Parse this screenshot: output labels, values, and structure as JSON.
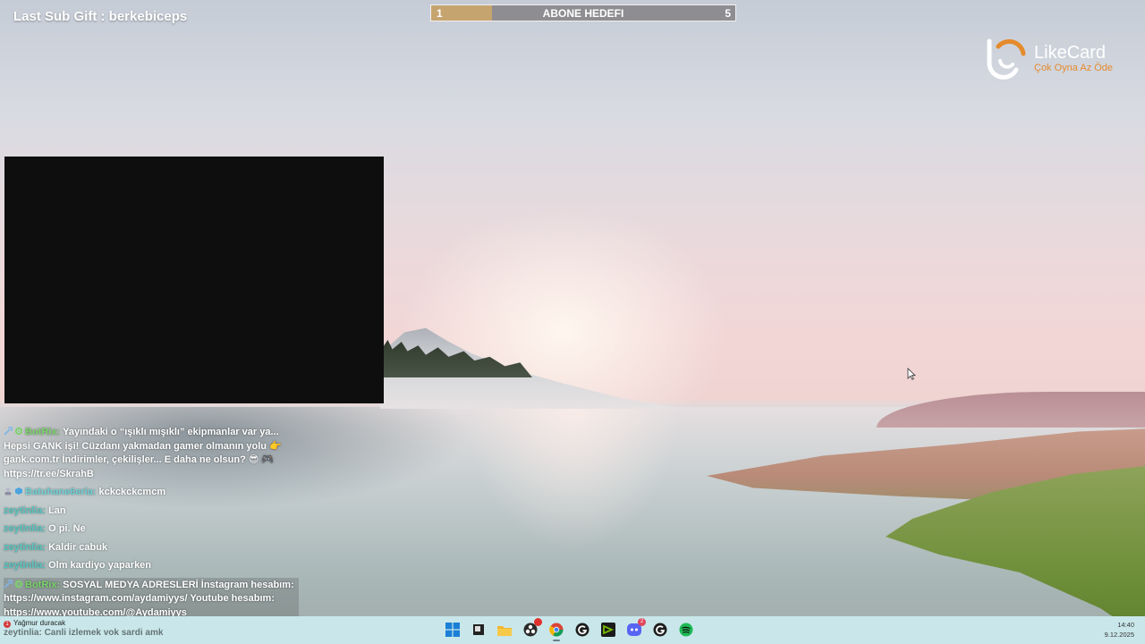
{
  "overlay": {
    "last_sub_gift": "Last Sub Gift : berkebiceps"
  },
  "sub_goal": {
    "title": "ABONE HEDEFI",
    "current": "1",
    "target": "5",
    "progress_fraction": 0.2,
    "fill_color": "#c6a46f",
    "track_color": "#8e8d91"
  },
  "sponsor": {
    "name": "LikeCard",
    "tagline": "Çok Oyna Az Öde",
    "accent_color": "#e58b2c"
  },
  "chat": {
    "messages": [
      {
        "user": "BotRix:",
        "text": "Yayındaki o “ışıklı mışıklı” ekipmanlar var ya... Hepsi GANK işi! Cüzdanı yakmadan gamer olmanın yolu 👉 gank.com.tr İndirimler, çekilişler... E daha ne olsun? 😎 🎮 https://tr.ee/SkrahB"
      },
      {
        "user": "Batuhane6eria:",
        "text": "kckckckcmcm"
      },
      {
        "user": "zeytinlia:",
        "text": "Lan"
      },
      {
        "user": "zeytinlia:",
        "text": "O pi. Ne"
      },
      {
        "user": "zeytinlia:",
        "text": "Kaldir cabuk"
      },
      {
        "user": "zeytinlia:",
        "text": "Olm kardiyo yaparken"
      },
      {
        "user": "BotRix:",
        "text": "SOSYAL MEDYA ADRESLERİ İnstagram hesabım: https://www.instagram.com/aydamiyys/ Youtube hesabım: https://www.youtube.com/@Aydamiyys"
      },
      {
        "user": "zeytinlia:",
        "text": "Canli izlemek vok sardi amk"
      }
    ]
  },
  "taskbar": {
    "weather_badge": "1",
    "weather_text": "Yağmur duracak",
    "discord_badge": "2",
    "time": "14:40",
    "date": "9.12.2025",
    "icons": [
      "windows-start-icon",
      "task-view-icon",
      "file-explorer-icon",
      "obs-icon",
      "chrome-icon",
      "gog-galaxy-icon",
      "nvidia-icon",
      "discord-icon",
      "epic-g-icon",
      "spotify-icon"
    ]
  }
}
